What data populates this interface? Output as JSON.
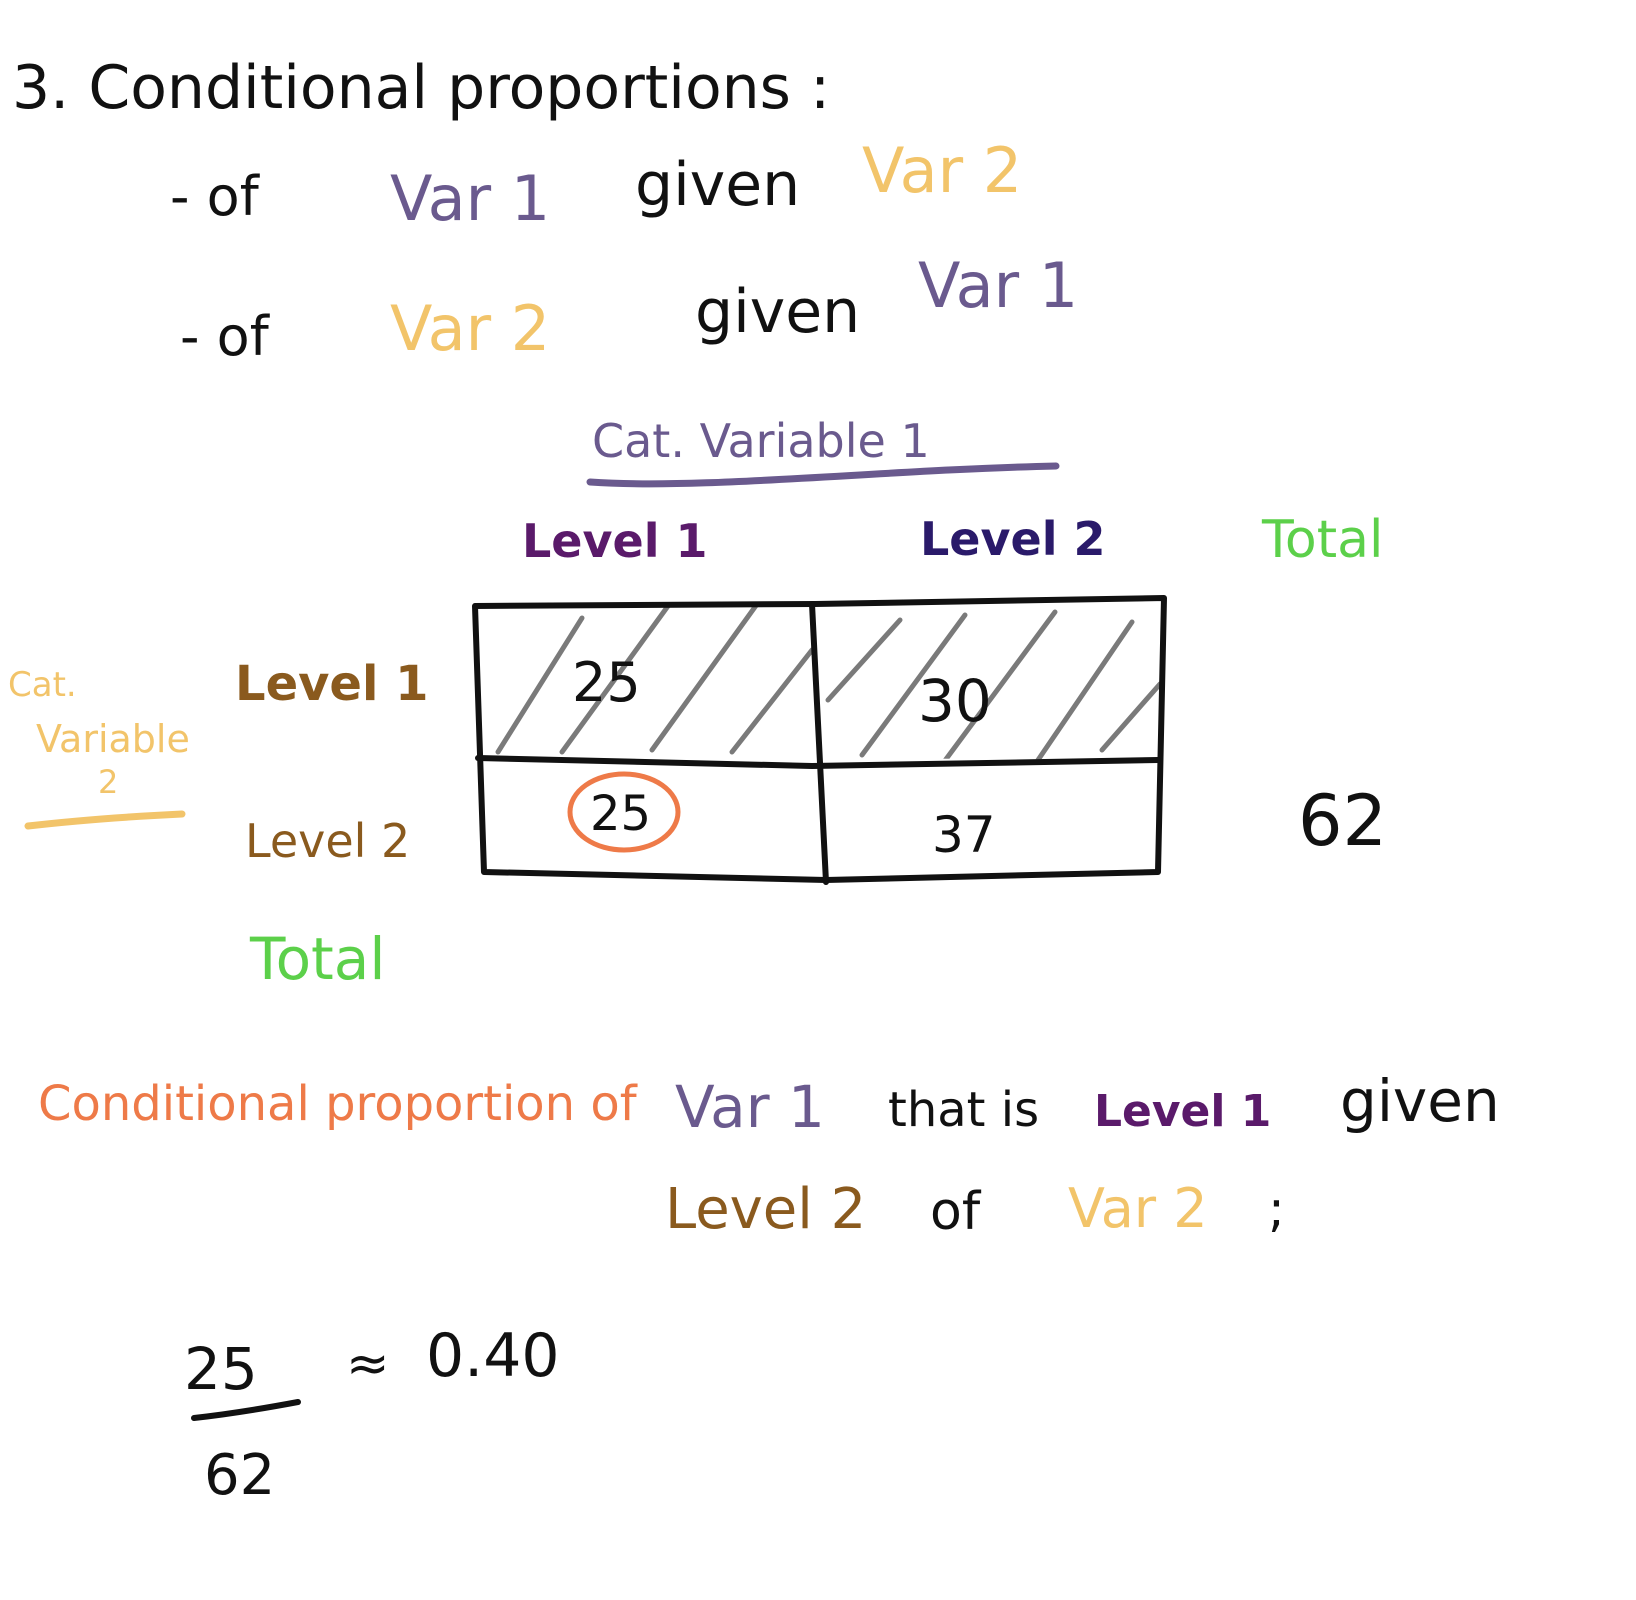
{
  "colors": {
    "black": "#111111",
    "purple": "#6a5a8e",
    "yellow": "#f2c46a",
    "brown": "#8a5a1e",
    "dark_purple": "#5a1a6a",
    "navy": "#2a1a6a",
    "green": "#5cd04a",
    "orange": "#ee7a48",
    "gray": "#7a7a7a"
  },
  "heading": "3. Conditional proportions :",
  "bullets": [
    {
      "dash": "- of",
      "first": "Var 1",
      "given": "given",
      "second": "Var 2"
    },
    {
      "dash": "- of",
      "first": "Var 2",
      "given": "given",
      "second": "Var 1"
    }
  ],
  "table": {
    "var1_title": "Cat. Variable 1",
    "col_labels": [
      "Level 1",
      "Level 2"
    ],
    "total_col_label": "Total",
    "var2_title": [
      "Cat.",
      "Variable",
      "2"
    ],
    "row_labels": [
      "Level 1",
      "Level 2"
    ],
    "total_row_label": "Total",
    "cells": [
      [
        "25",
        "30"
      ],
      [
        "25",
        "37"
      ]
    ],
    "row_totals": [
      "",
      "62"
    ]
  },
  "statement": {
    "p1": "Conditional proportion of",
    "p2": "Var 1",
    "p3": "that is",
    "p4": "Level 1",
    "p5": "given",
    "p6": "Level 2",
    "p7": "of",
    "p8": "Var 2",
    "p9": ";"
  },
  "calc": {
    "numerator": "25",
    "denominator": "62",
    "approx": "≈",
    "result": "0.40"
  }
}
